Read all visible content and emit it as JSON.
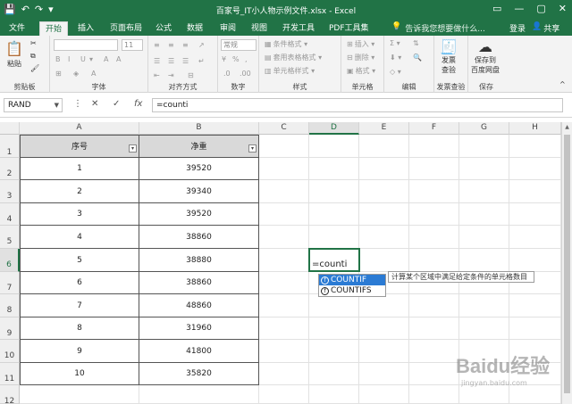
{
  "titlebar": {
    "title": "百家号_IT小人物示例文件.xlsx - Excel",
    "qat": [
      "💾",
      "↶",
      "↷",
      "▾"
    ],
    "win_buttons": [
      "▭",
      "—",
      "▢",
      "✕"
    ]
  },
  "tabs": [
    {
      "label": "文件"
    },
    {
      "label": "开始"
    },
    {
      "label": "插入"
    },
    {
      "label": "页面布局"
    },
    {
      "label": "公式"
    },
    {
      "label": "数据"
    },
    {
      "label": "审阅"
    },
    {
      "label": "视图"
    },
    {
      "label": "开发工具"
    },
    {
      "label": "PDF工具集"
    }
  ],
  "tell_me": "告诉我您想要做什么...",
  "login": "登录",
  "share": "共享",
  "ribbon": {
    "clipboard": {
      "paste": "粘贴",
      "label": "剪贴板"
    },
    "font": {
      "size": "11",
      "label": "字体",
      "buttons": [
        "B",
        "I",
        "U",
        "▾",
        "A",
        "A"
      ]
    },
    "alignment": {
      "label": "对齐方式"
    },
    "number": {
      "format": "常规",
      "label": "数字",
      "buttons": [
        "%",
        ",",
        ".0",
        ".00"
      ]
    },
    "styles": {
      "items": [
        "条件格式 ▾",
        "套用表格格式 ▾",
        "单元格样式 ▾"
      ],
      "label": "样式"
    },
    "cells": {
      "items": [
        "插入 ▾",
        "删除 ▾",
        "格式 ▾"
      ],
      "label": "单元格"
    },
    "editing": {
      "label": "编辑"
    },
    "invoice": {
      "button": [
        "发票",
        "查验"
      ],
      "label": "发票查验"
    },
    "save": {
      "button": [
        "保存到",
        "百度网盘"
      ],
      "label": "保存"
    }
  },
  "formula_bar": {
    "name_box": "RAND",
    "cancel": "✕",
    "enter": "✓",
    "fx": "fx",
    "formula": "=counti"
  },
  "columns": [
    "A",
    "B",
    "C",
    "D",
    "E",
    "F",
    "G",
    "H"
  ],
  "rows": [
    "1",
    "2",
    "3",
    "4",
    "5",
    "6",
    "7",
    "8",
    "9",
    "10",
    "11",
    "12"
  ],
  "table": {
    "headers": [
      "序号",
      "净重"
    ],
    "rows": [
      [
        "1",
        "39520"
      ],
      [
        "2",
        "39340"
      ],
      [
        "3",
        "39520"
      ],
      [
        "4",
        "38860"
      ],
      [
        "5",
        "38880"
      ],
      [
        "6",
        "38860"
      ],
      [
        "7",
        "48860"
      ],
      [
        "8",
        "31960"
      ],
      [
        "9",
        "41800"
      ],
      [
        "10",
        "35820"
      ]
    ]
  },
  "active_cell": {
    "ref": "D6",
    "value": "=counti"
  },
  "autocomplete": {
    "items": [
      "COUNTIF",
      "COUNTIFS"
    ],
    "selected": 0,
    "tooltip": "计算某个区域中满足给定条件的单元格数目"
  },
  "watermark": {
    "logo": "Baidu经验",
    "site": "jingyan.baidu.com"
  },
  "colors": {
    "accent": "#217346",
    "highlight": "#2b7bd4"
  }
}
